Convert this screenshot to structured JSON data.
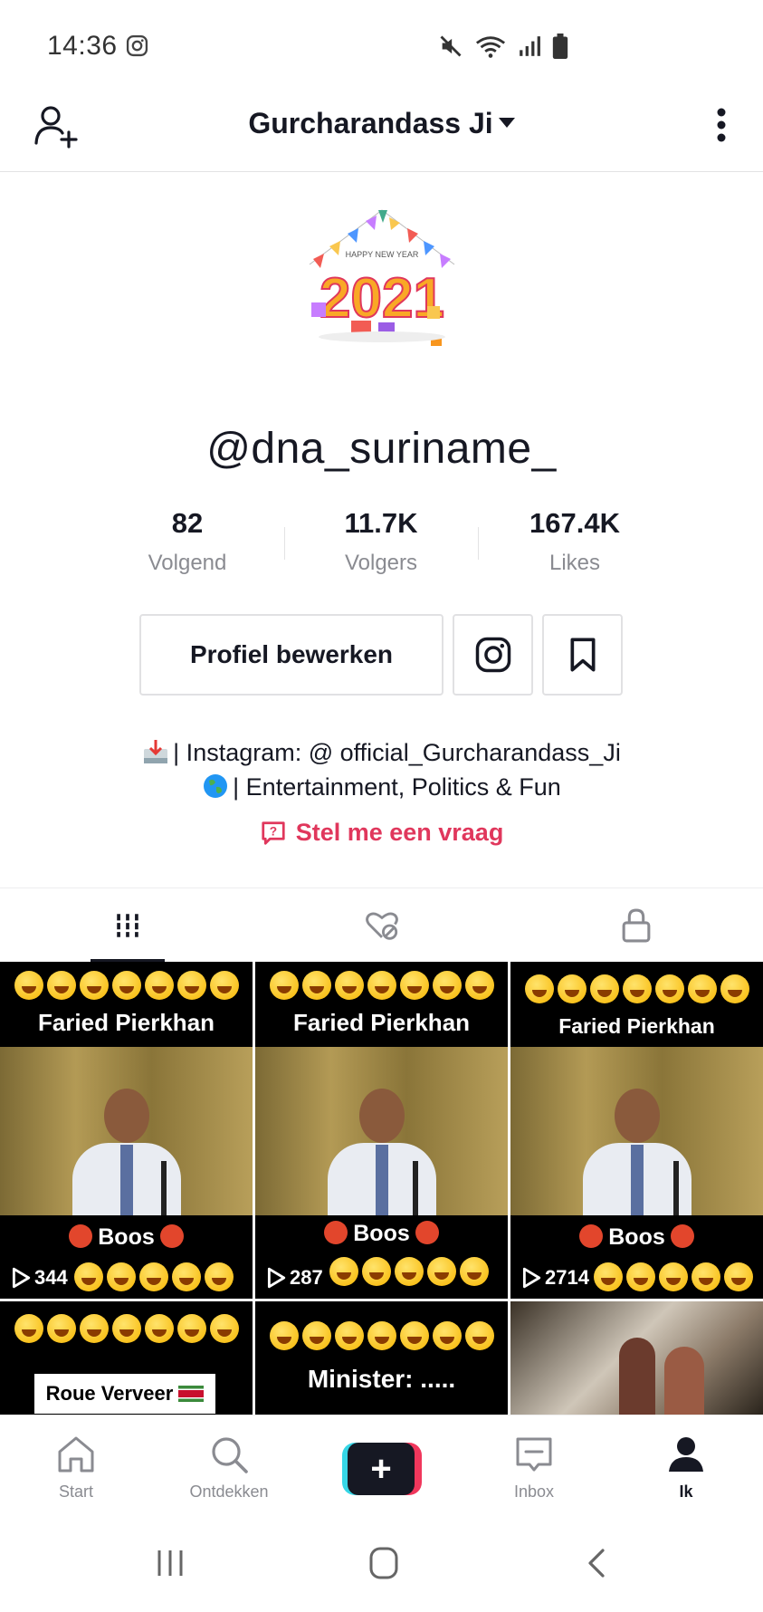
{
  "status": {
    "time": "14:36"
  },
  "header": {
    "title": "Gurcharandass Ji"
  },
  "avatar": {
    "banner": "HAPPY NEW YEAR",
    "year": "2021"
  },
  "profile": {
    "username": "@dna_suriname_",
    "stats": [
      {
        "value": "82",
        "label": "Volgend"
      },
      {
        "value": "11.7K",
        "label": "Volgers"
      },
      {
        "value": "167.4K",
        "label": "Likes"
      }
    ],
    "edit_label": "Profiel bewerken",
    "bio_line1": "| Instagram: @ official_Gurcharandass_Ji",
    "bio_line2": "| Entertainment, Politics & Fun",
    "question_label": "Stel me een vraag"
  },
  "tabs": [
    "videos-grid-icon",
    "liked-hidden-icon",
    "private-lock-icon"
  ],
  "videos": [
    {
      "caption": "Faried Pierkhan",
      "subcaption": "Boos",
      "views": "344"
    },
    {
      "caption": "Faried Pierkhan",
      "subcaption": "Boos",
      "views": "287"
    },
    {
      "caption": "Faried Pierkhan",
      "subcaption": "Boos",
      "views": "2714"
    },
    {
      "caption": "Roue Verveer"
    },
    {
      "caption": "Minister: ....."
    },
    {
      "caption": ""
    }
  ],
  "nav": {
    "start": "Start",
    "discover": "Ontdekken",
    "create": "+",
    "inbox": "Inbox",
    "me": "Ik"
  },
  "colors": {
    "accent": "#e0375c",
    "text": "#161823",
    "muted": "#8a8b91"
  }
}
